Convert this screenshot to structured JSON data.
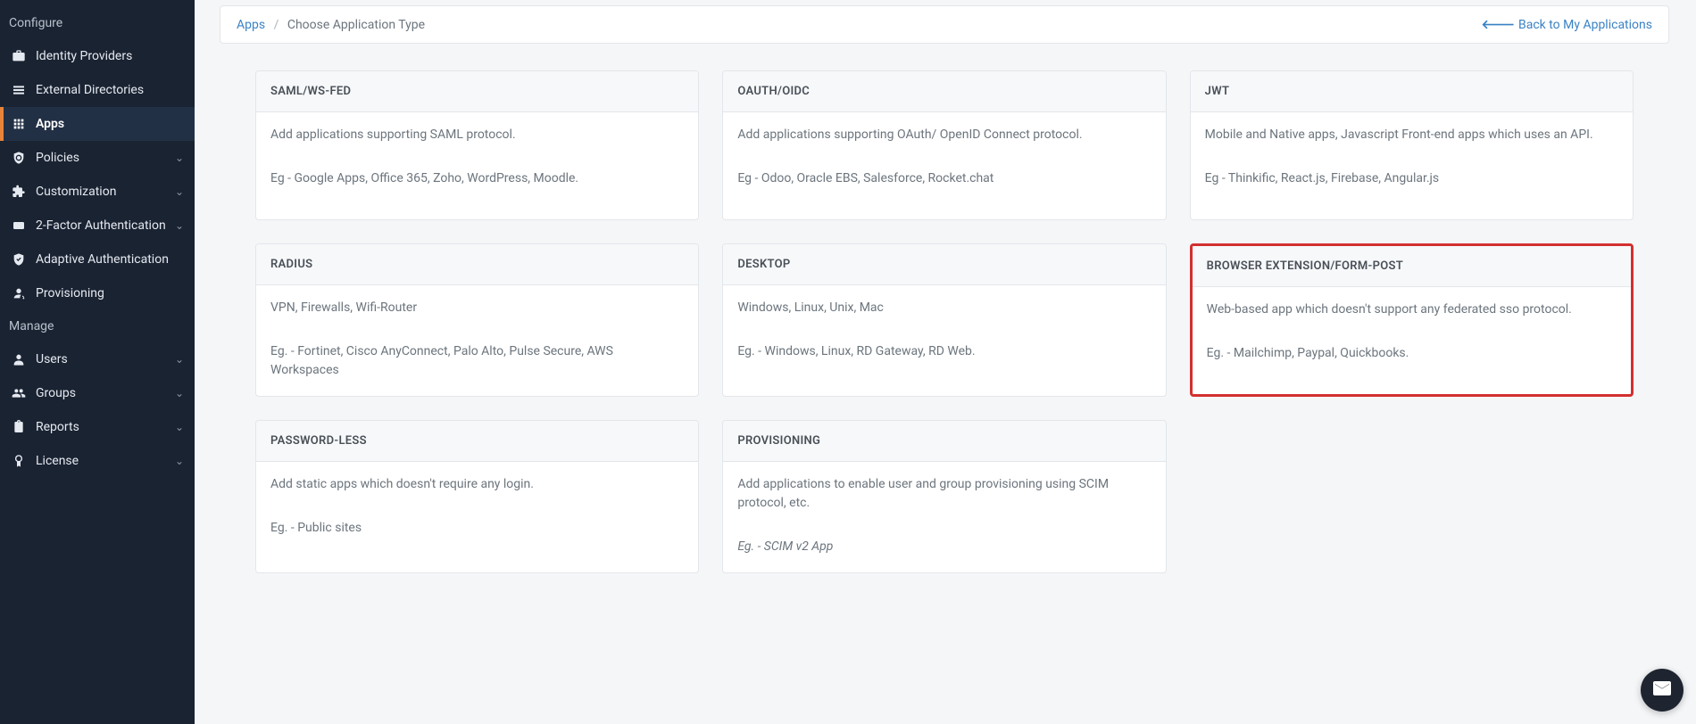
{
  "sidebar": {
    "section_configure": "Configure",
    "section_manage": "Manage",
    "items_configure": [
      {
        "label": "Identity Providers",
        "expandable": false
      },
      {
        "label": "External Directories",
        "expandable": false
      },
      {
        "label": "Apps",
        "expandable": false,
        "active": true
      },
      {
        "label": "Policies",
        "expandable": true
      },
      {
        "label": "Customization",
        "expandable": true
      },
      {
        "label": "2-Factor Authentication",
        "expandable": true
      },
      {
        "label": "Adaptive Authentication",
        "expandable": false
      },
      {
        "label": "Provisioning",
        "expandable": false
      }
    ],
    "items_manage": [
      {
        "label": "Users",
        "expandable": true
      },
      {
        "label": "Groups",
        "expandable": true
      },
      {
        "label": "Reports",
        "expandable": true
      },
      {
        "label": "License",
        "expandable": true
      }
    ]
  },
  "breadcrumb": {
    "root": "Apps",
    "current": "Choose Application Type"
  },
  "back_link": "Back to My Applications",
  "cards": [
    {
      "title": "SAML/WS-FED",
      "desc": "Add applications supporting SAML protocol.",
      "example": "Eg - Google Apps, Office 365, Zoho, WordPress, Moodle."
    },
    {
      "title": "OAUTH/OIDC",
      "desc": "Add applications supporting OAuth/ OpenID Connect protocol.",
      "example": "Eg - Odoo, Oracle EBS, Salesforce, Rocket.chat"
    },
    {
      "title": "JWT",
      "desc": "Mobile and Native apps, Javascript Front-end apps which uses an API.",
      "example": "Eg - Thinkific, React.js, Firebase, Angular.js"
    },
    {
      "title": "RADIUS",
      "desc": "VPN, Firewalls, Wifi-Router",
      "example": "Eg. - Fortinet, Cisco AnyConnect, Palo Alto, Pulse Secure, AWS Workspaces"
    },
    {
      "title": "DESKTOP",
      "desc": "Windows, Linux, Unix, Mac",
      "example": "Eg. - Windows, Linux, RD Gateway, RD Web."
    },
    {
      "title": "BROWSER EXTENSION/FORM-POST",
      "desc": "Web-based app which doesn't support any federated sso protocol.",
      "example": "Eg. - Mailchimp, Paypal, Quickbooks.",
      "highlighted": true
    },
    {
      "title": "PASSWORD-LESS",
      "desc": "Add static apps which doesn't require any login.",
      "example": "Eg. - Public sites"
    },
    {
      "title": "PROVISIONING",
      "desc": "Add applications to enable user and group provisioning using SCIM protocol, etc.",
      "example": "Eg. - SCIM v2 App",
      "italic_example": true
    }
  ]
}
